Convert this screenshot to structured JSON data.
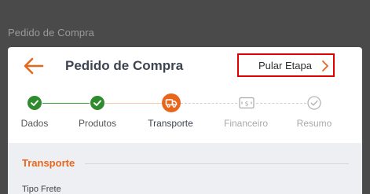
{
  "window": {
    "title": "Pedido de Compra"
  },
  "header": {
    "title": "Pedido de Compra",
    "skip_label": "Pular Etapa",
    "accent": "#e8661c",
    "skip_border": "#e00000"
  },
  "stepper": {
    "steps": [
      {
        "label": "Dados",
        "status": "done",
        "icon": "check-icon"
      },
      {
        "label": "Produtos",
        "status": "done",
        "icon": "check-icon"
      },
      {
        "label": "Transporte",
        "status": "active",
        "icon": "truck-icon"
      },
      {
        "label": "Financeiro",
        "status": "pending",
        "icon": "money-icon"
      },
      {
        "label": "Resumo",
        "status": "pending",
        "icon": "check-circle-icon"
      }
    ],
    "colors": {
      "done": "#2e8b2e",
      "active": "#e8661c",
      "pending": "#bdbdbd"
    }
  },
  "section": {
    "title": "Transporte",
    "fields": [
      {
        "label": "Tipo Frete"
      }
    ]
  }
}
